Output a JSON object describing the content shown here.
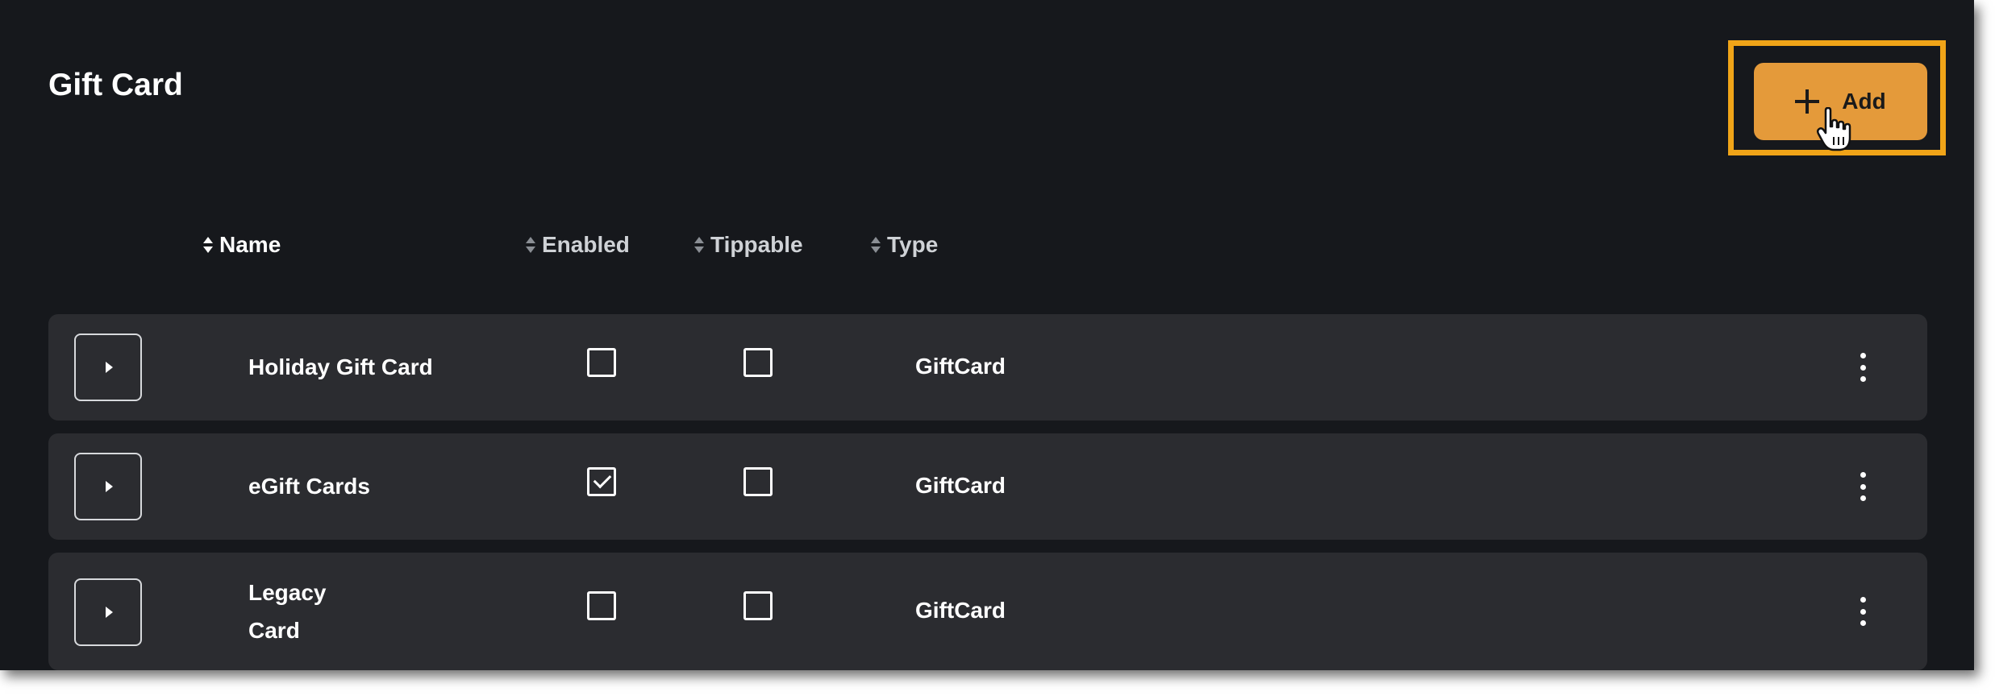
{
  "page": {
    "title": "Gift Card"
  },
  "toolbar": {
    "add_label": "Add"
  },
  "table": {
    "columns": [
      "Name",
      "Enabled",
      "Tippable",
      "Type"
    ],
    "rows": [
      {
        "name": "Holiday Gift Card",
        "enabled": false,
        "tippable": false,
        "type": "GiftCard"
      },
      {
        "name": "eGift Cards",
        "enabled": true,
        "tippable": false,
        "type": "GiftCard"
      },
      {
        "name": "Legacy Card",
        "name_lines": [
          "Legacy",
          "Card"
        ],
        "enabled": false,
        "tippable": false,
        "type": "GiftCard"
      }
    ]
  },
  "colors": {
    "background": "#16181c",
    "row_background": "#2b2c30",
    "accent_button": "#e49a3a",
    "highlight_border": "#f0a418"
  },
  "icons": {
    "add": "plus-icon",
    "sort": "sort-icon",
    "expand": "caret-right-icon",
    "row_menu": "kebab-menu-icon",
    "cursor": "hand-pointer-icon"
  }
}
